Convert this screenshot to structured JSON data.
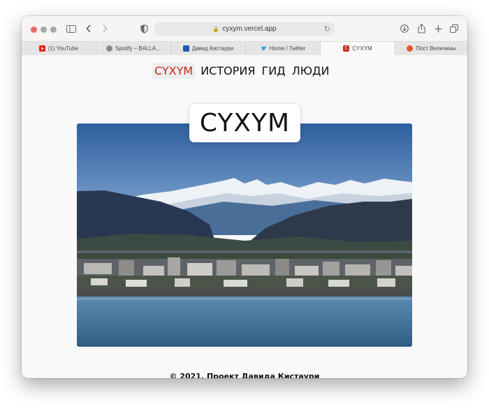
{
  "browser": {
    "address_url": "cyxym.vercel.app",
    "tabs": [
      {
        "label": "(1) YouTube",
        "icon": "youtube-icon",
        "color": "#e62117"
      },
      {
        "label": "Spotify – BALLA...",
        "icon": "spotify-icon",
        "color": "#8a8a8a"
      },
      {
        "label": "Давид Кистаури",
        "icon": "app-icon",
        "color": "#1d5ab5"
      },
      {
        "label": "Home / Twitter",
        "icon": "twitter-icon",
        "color": "#1da1f2"
      },
      {
        "label": "CYXYM",
        "icon": "site-favicon-c",
        "color": "#c4281c"
      },
      {
        "label": "Пост Величины",
        "icon": "fox-icon",
        "color": "#e2592a"
      }
    ]
  },
  "nav": {
    "brand": "CYXYM",
    "items": [
      "ИСТОРИЯ",
      "ГИД",
      "ЛЮДИ"
    ]
  },
  "hero": {
    "title": "CYXYM",
    "image_description": "Panorama of a coastal city with snowy mountains"
  },
  "footer": {
    "text": "© 2021. Проект Давида Кистаури"
  },
  "colors": {
    "brand": "#c4281c",
    "sky": "#5b82b8",
    "sea": "#3f6f95"
  }
}
